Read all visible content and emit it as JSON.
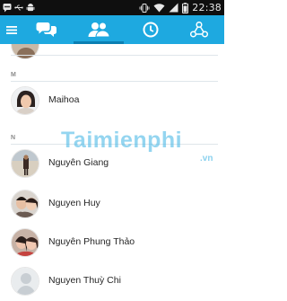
{
  "status_bar": {
    "time": "22:38",
    "icons": [
      "bbm-notification-icon",
      "usb-icon",
      "android-icon",
      "vibrate-icon",
      "wifi-icon",
      "signal-icon",
      "battery-icon"
    ]
  },
  "app_bar": {
    "tabs": [
      {
        "name": "menu",
        "icon": "menu-icon"
      },
      {
        "name": "chats",
        "icon": "chat-bubbles-icon"
      },
      {
        "name": "contacts",
        "icon": "contacts-icon",
        "selected": true
      },
      {
        "name": "recent",
        "icon": "clock-icon"
      },
      {
        "name": "groups",
        "icon": "share-network-icon"
      }
    ],
    "colors": {
      "bar": "#1ea9e0",
      "selected_underline": "#0b7fb3"
    }
  },
  "contacts": {
    "sections": [
      {
        "letter": "M"
      },
      {
        "letter": "N"
      }
    ],
    "items": [
      {
        "name": "Maihoa"
      },
      {
        "name": "Nguyên Giang"
      },
      {
        "name": "Nguyen Huy"
      },
      {
        "name": "Nguyên Phung Thảo"
      },
      {
        "name": "Nguyen Thuỳ Chi"
      }
    ]
  },
  "watermark": {
    "text": "Taimienphi",
    "suffix": ".vn"
  }
}
